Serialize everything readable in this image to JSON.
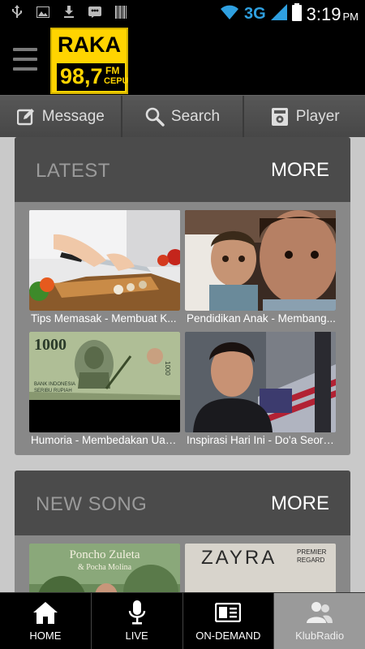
{
  "status_bar": {
    "left_icons": [
      "usb-icon",
      "image-icon",
      "download-icon",
      "bbm-icon",
      "barcode-icon"
    ],
    "network": "3G",
    "time": "3:19",
    "ampm": "PM"
  },
  "app_bar": {
    "logo": {
      "name": "RAKA",
      "frequency": "98,7",
      "band": "FM",
      "city": "CEPU"
    }
  },
  "toolbar": {
    "message_label": "Message",
    "search_label": "Search",
    "player_label": "Player"
  },
  "latest": {
    "title": "LATEST",
    "more": "MORE",
    "items": [
      {
        "caption": "Tips Memasak - Membuat K..."
      },
      {
        "caption": "Pendidikan Anak - Membang..."
      },
      {
        "caption": "Humoria - Membedakan Uan..."
      },
      {
        "caption": "Inspirasi Hari Ini - Do'a Seora..."
      }
    ]
  },
  "new_song": {
    "title": "NEW SONG",
    "more": "MORE",
    "items": [
      {
        "cover_text": "Poncho Zuleta",
        "cover_subtext": "& Pocha Molina"
      },
      {
        "cover_text": "ZAYRA",
        "cover_subtext": "PREMIER REGARD"
      }
    ]
  },
  "bottom_nav": {
    "home": "HOME",
    "live": "LIVE",
    "on_demand": "ON-DEMAND",
    "klubradio": "KlubRadio"
  },
  "colors": {
    "logo_yellow": "#ffd400",
    "network_blue": "#2fa0e0",
    "card_header": "#4b4b4b",
    "content_bg": "#c9c9c9"
  }
}
